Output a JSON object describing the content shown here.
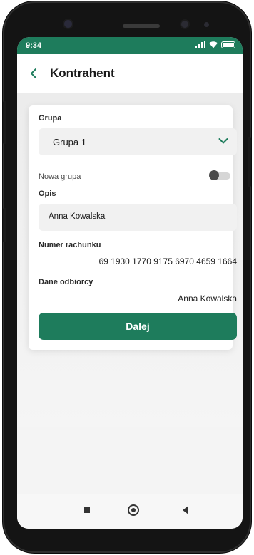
{
  "status": {
    "time": "9:34"
  },
  "header": {
    "title": "Kontrahent"
  },
  "form": {
    "group_label": "Grupa",
    "group_value": "Grupa 1",
    "new_group_label": "Nowa grupa",
    "new_group_enabled": false,
    "description_label": "Opis",
    "description_value": "Anna Kowalska",
    "account_label": "Numer rachunku",
    "account_value": "69 1930 1770 9175 6970 4659 1664",
    "recipient_label": "Dane odbiorcy",
    "recipient_value": "Anna Kowalska",
    "next_button": "Dalej"
  },
  "colors": {
    "brand": "#1e7c5c",
    "toggle_knob": "#4a4a4a"
  },
  "icons": {
    "back": "chevron-left-icon",
    "dropdown": "chevron-down-icon",
    "signal": "signal-icon",
    "wifi": "wifi-icon",
    "battery": "battery-icon",
    "nav_recents": "recents-icon",
    "nav_home": "home-icon",
    "nav_back": "back-triangle-icon"
  }
}
